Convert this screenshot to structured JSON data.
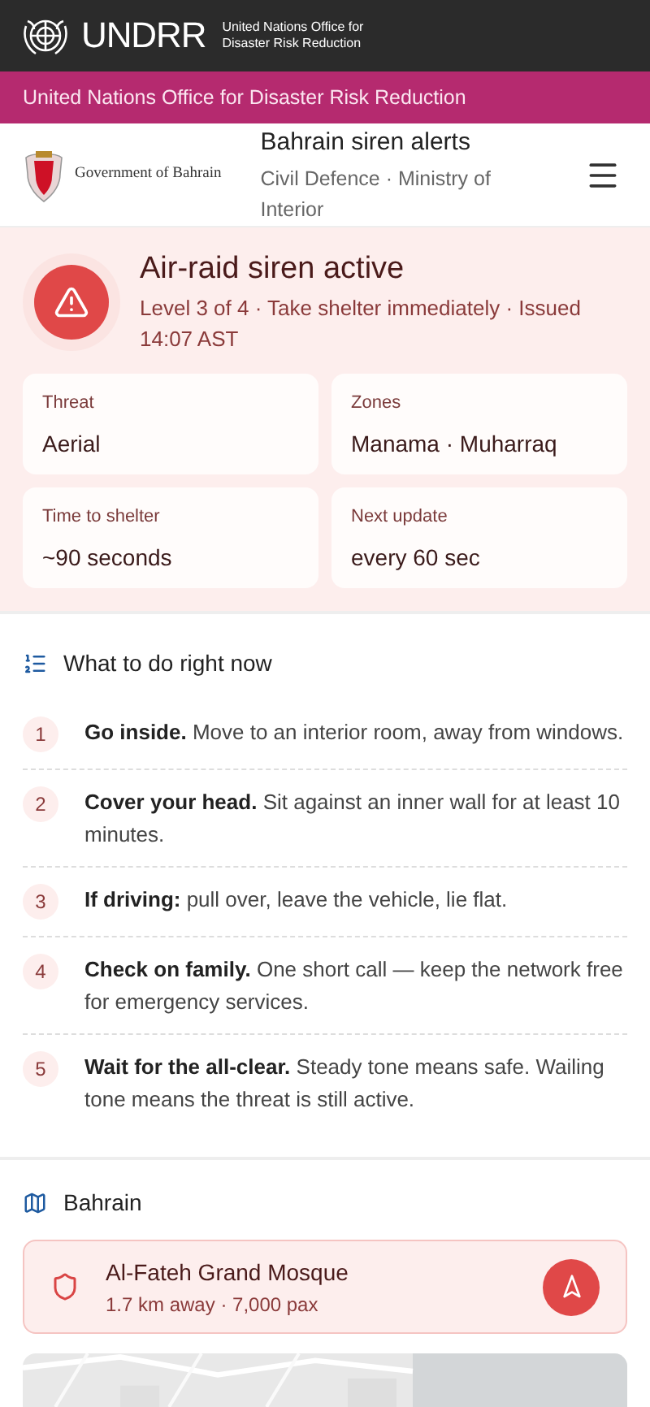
{
  "topbar": {
    "brand": "UNDRR",
    "brand_sub": [
      "United Nations Office for",
      "Disaster Risk Reduction"
    ]
  },
  "banner": "United Nations Office for Disaster Risk Reduction",
  "header": {
    "gov": "Government of Bahrain",
    "title": "Bahrain siren alerts",
    "subtitle": "Civil Defence · Ministry of Interior"
  },
  "alert": {
    "title": "Air-raid siren active",
    "detail": "Level 3 of 4 · Take shelter immediately · Issued 14:07 AST",
    "facts": [
      {
        "label": "Threat",
        "value": "Aerial"
      },
      {
        "label": "Zones",
        "value": "Manama · Muharraq"
      },
      {
        "label": "Time to shelter",
        "value": "~90 seconds"
      },
      {
        "label": "Next update",
        "value": "every 60 sec"
      }
    ]
  },
  "steps": {
    "title": "What to do right now",
    "items": [
      {
        "number": "1",
        "text": "**Go inside.** Move to an interior room, away from windows."
      },
      {
        "number": "2",
        "text": "**Cover your head.** Sit against an inner wall for at least 10 minutes."
      },
      {
        "number": "3",
        "text": "**If driving:** pull over, leave the vehicle, lie flat."
      },
      {
        "number": "4",
        "text": "**Check on family.** One short call — keep the network free for emergency services."
      },
      {
        "number": "5",
        "text": "**Wait for the all-clear.** Steady tone means safe. Wailing tone means the threat is still active."
      }
    ]
  },
  "map": {
    "title": "Bahrain",
    "shelter": {
      "name": "Al-Fateh Grand Mosque",
      "detail": "1.7 km away · 7,000 pax"
    }
  }
}
